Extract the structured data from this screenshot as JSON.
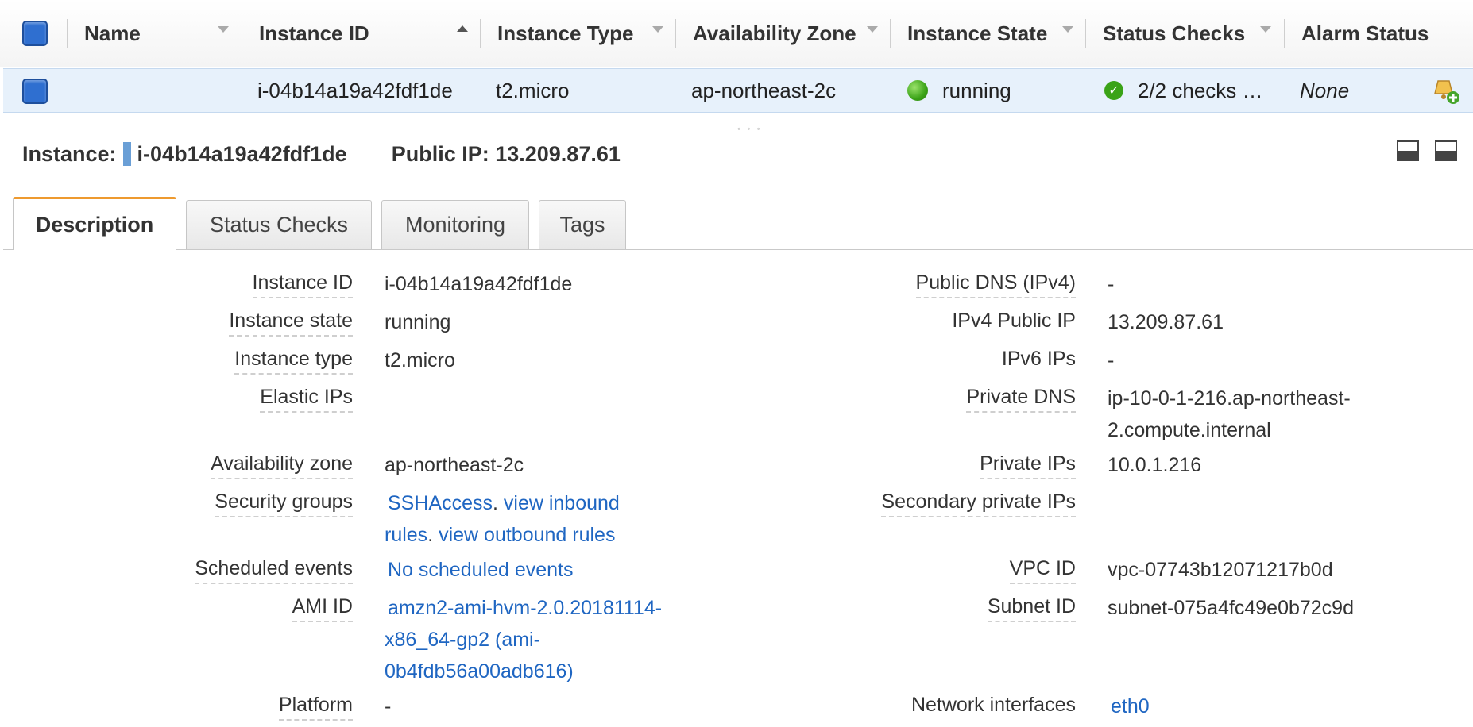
{
  "grid": {
    "columns": [
      "Name",
      "Instance ID",
      "Instance Type",
      "Availability Zone",
      "Instance State",
      "Status Checks",
      "Alarm Status"
    ],
    "row": {
      "name": "",
      "instance_id": "i-04b14a19a42fdf1de",
      "instance_type": "t2.micro",
      "availability_zone": "ap-northeast-2c",
      "instance_state": "running",
      "status_checks": "2/2 checks …",
      "alarm_status": "None"
    }
  },
  "summary": {
    "instance_label": "Instance:",
    "instance_id": "i-04b14a19a42fdf1de",
    "public_ip": "Public IP: 13.209.87.61"
  },
  "tabs": [
    "Description",
    "Status Checks",
    "Monitoring",
    "Tags"
  ],
  "description": {
    "left": {
      "instance_id": {
        "label": "Instance ID",
        "value": "i-04b14a19a42fdf1de"
      },
      "instance_state": {
        "label": "Instance state",
        "value": "running"
      },
      "instance_type": {
        "label": "Instance type",
        "value": "t2.micro"
      },
      "elastic_ips": {
        "label": "Elastic IPs",
        "value": ""
      },
      "availability_zone": {
        "label": "Availability zone",
        "value": "ap-northeast-2c"
      },
      "security_groups": {
        "label": "Security groups",
        "group": "SSHAccess",
        "inbound": "view inbound",
        "inbound_2": "rules",
        "outbound": "view outbound rules"
      },
      "scheduled_events": {
        "label": "Scheduled events",
        "value": "No scheduled events"
      },
      "ami_id": {
        "label": "AMI ID",
        "line1": "amzn2-ami-hvm-2.0.20181114-",
        "line2": "x86_64-gp2 (ami-",
        "line3": "0b4fdb56a00adb616)"
      },
      "platform": {
        "label": "Platform",
        "value": "-"
      }
    },
    "right": {
      "public_dns": {
        "label": "Public DNS (IPv4)",
        "value": "-"
      },
      "ipv4_public_ip": {
        "label": "IPv4 Public IP",
        "value": "13.209.87.61"
      },
      "ipv6_ips": {
        "label": "IPv6 IPs",
        "value": "-"
      },
      "private_dns": {
        "label": "Private DNS",
        "line1": "ip-10-0-1-216.ap-northeast-",
        "line2": "2.compute.internal"
      },
      "private_ips": {
        "label": "Private IPs",
        "value": "10.0.1.216"
      },
      "secondary_private_ips": {
        "label": "Secondary private IPs",
        "value": ""
      },
      "vpc_id": {
        "label": "VPC ID",
        "value": "vpc-07743b12071217b0d"
      },
      "subnet_id": {
        "label": "Subnet ID",
        "value": "subnet-075a4fc49e0b72c9d"
      },
      "network_interfaces": {
        "label": "Network interfaces",
        "value": "eth0"
      }
    }
  },
  "colors": {
    "accent_tab": "#ee9a2f",
    "link": "#1f66c2",
    "selected_row": "#e7f1fb",
    "running": "#3aa317"
  }
}
